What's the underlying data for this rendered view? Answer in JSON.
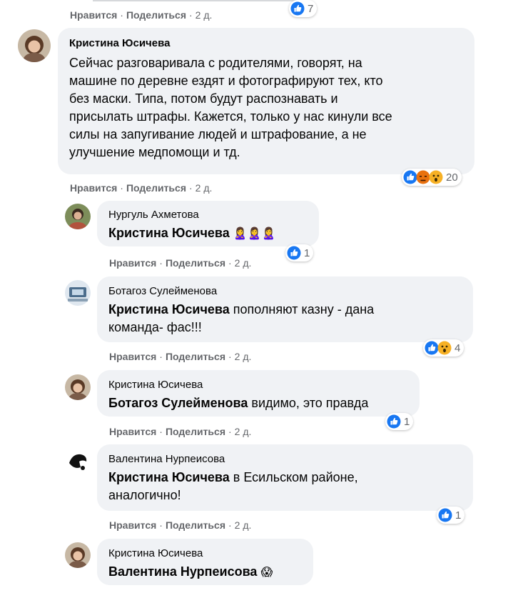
{
  "actions": {
    "like": "Нравится",
    "share": "Поделиться",
    "time": "2 д."
  },
  "top": {
    "reaction_count": "7"
  },
  "comment": {
    "author": "Кристина Юсичева",
    "lines": [
      "Сейчас разговаривала с родителями, говорят, на",
      "машине по деревне ездят и фотографируют тех, кто",
      "без маски. Типа, потом будут распознавать и",
      "присылать штрафы. Кажется, только у нас кинули все",
      "силы на запугивание людей и штрафование, а не",
      "улучшение медпомощи и тд."
    ],
    "reaction_count": "20"
  },
  "replies": [
    {
      "author": "Нургуль Ахметова",
      "mention": "Кристина Юсичева",
      "text": "🙎‍♀️🙎‍♀️🙎‍♀️",
      "reaction_count": "1"
    },
    {
      "author": "Ботагоз Сулейменова",
      "mention": "Кристина Юсичева",
      "text_line1": "пополняют казну - дана",
      "text_line2": "команда- фас!!!",
      "reaction_count": "4"
    },
    {
      "author": "Кристина Юсичева",
      "mention": "Ботагоз Сулейменова",
      "text": "видимо, это правда",
      "reaction_count": "1"
    },
    {
      "author": "Валентина Нурпеисова",
      "mention": "Кристина Юсичева",
      "text_line1": "в Есильском районе,",
      "text_line2": "аналогично!",
      "reaction_count": "1"
    },
    {
      "author": "Кристина Юсичева",
      "mention": "Валентина Нурпеисова",
      "text": "😱"
    }
  ],
  "colors": {
    "bubble": "#f0f2f5",
    "like": "#1877f2",
    "meta": "#65676b",
    "haha": "#f7b125",
    "angry": "#e9710f"
  }
}
